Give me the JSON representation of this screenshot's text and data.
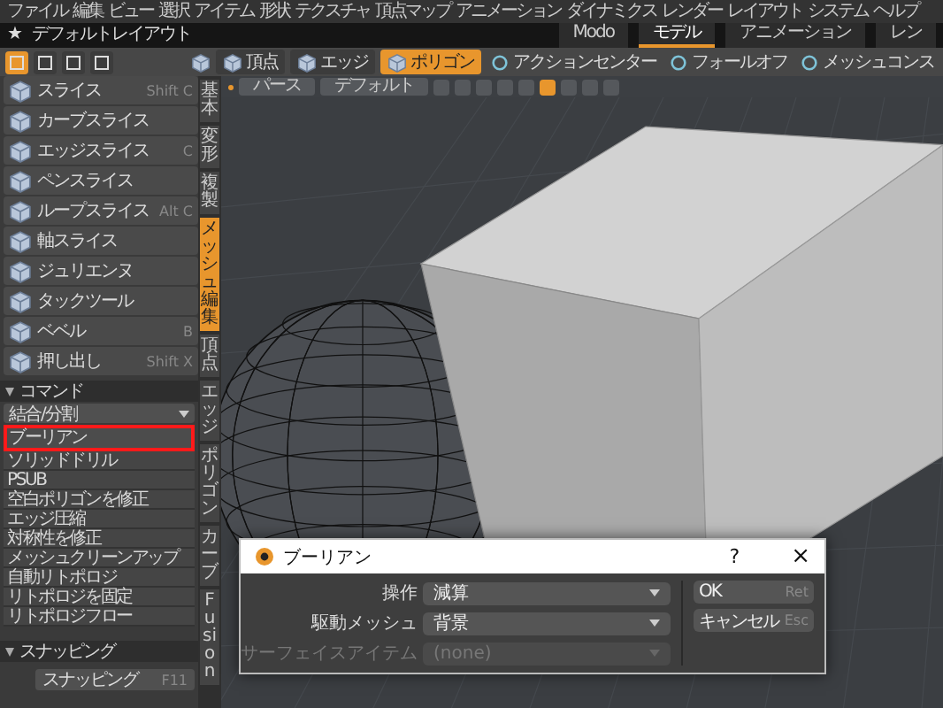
{
  "menu_bar": [
    "ファイル",
    "編集",
    "ビュー",
    "選択",
    "アイテム",
    "形状",
    "テクスチャ",
    "頂点マップ",
    "アニメーション",
    "ダイナミクス",
    "レンダー",
    "レイアウト",
    "システム",
    "ヘルプ"
  ],
  "title_bar": {
    "icon": "★",
    "title": "デフォルトレイアウト",
    "tabs": [
      {
        "label": "Modo",
        "selected": false
      },
      {
        "label": "モデル",
        "selected": true
      },
      {
        "label": "アニメーション",
        "selected": false
      },
      {
        "label": "レン",
        "selected": false
      }
    ]
  },
  "toolbar": {
    "tool_buttons": [
      {
        "selected": true
      },
      {
        "selected": false
      },
      {
        "selected": false
      },
      {
        "selected": false
      }
    ],
    "modes": [
      {
        "label": "頂点",
        "selected": false
      },
      {
        "label": "エッジ",
        "selected": false
      },
      {
        "label": "ポリゴン",
        "selected": true
      }
    ],
    "actions": [
      "アクションセンター",
      "フォールオフ",
      "メッシュコンス"
    ]
  },
  "tools": [
    {
      "label": "スライス",
      "shortcut": "Shift C"
    },
    {
      "label": "カーブスライス"
    },
    {
      "label": "エッジスライス",
      "shortcut": "C"
    },
    {
      "label": "ペンスライス"
    },
    {
      "label": "ループスライス",
      "shortcut": "Alt C"
    },
    {
      "label": "軸スライス"
    },
    {
      "label": "ジュリエンヌ"
    },
    {
      "label": "タックツール"
    },
    {
      "label": "ベベル",
      "shortcut": "B"
    },
    {
      "label": "押し出し",
      "shortcut": "Shift X"
    }
  ],
  "side_tabs": [
    {
      "label": "基本",
      "selected": false
    },
    {
      "label": "変形",
      "selected": false
    },
    {
      "label": "複製",
      "selected": false
    },
    {
      "label": "メッシュ編集",
      "selected": true
    },
    {
      "label": "頂点",
      "selected": false
    },
    {
      "label": "エッジ",
      "selected": false
    },
    {
      "label": "ポリゴン",
      "selected": false
    },
    {
      "label": "カーブ",
      "selected": false
    },
    {
      "label": "Fusion",
      "selected": false
    }
  ],
  "commands": {
    "title": "コマンド",
    "filter": "結合/分割",
    "items": [
      {
        "label": "ブーリアン",
        "highlighted": true
      },
      {
        "label": "ソリッドドリル",
        "highlighted": false
      },
      {
        "label": "PSUB",
        "highlighted": false
      },
      {
        "label": "空白ポリゴンを修正",
        "highlighted": false
      },
      {
        "label": "エッジ圧縮",
        "highlighted": false
      },
      {
        "label": "対称性を修正",
        "highlighted": false
      },
      {
        "label": "メッシュクリーンアップ",
        "highlighted": false
      },
      {
        "label": "自動リトポロジ",
        "highlighted": false
      },
      {
        "label": "リトポロジを固定",
        "highlighted": false
      },
      {
        "label": "リトポロジフロー",
        "highlighted": false
      }
    ]
  },
  "snapping": {
    "title": "スナッピング",
    "button": {
      "label": "スナッピング",
      "shortcut": "F11"
    }
  },
  "viewport": {
    "view": "パース",
    "style": "デフォルト",
    "shading_buttons": [
      {
        "selected": false
      },
      {
        "selected": false
      },
      {
        "selected": false
      },
      {
        "selected": false
      },
      {
        "selected": false
      },
      {
        "selected": true
      },
      {
        "selected": false
      },
      {
        "selected": false
      },
      {
        "selected": false
      }
    ]
  },
  "dialog": {
    "title": "ブーリアン",
    "help": "?",
    "close": "×",
    "fields": [
      {
        "label": "操作",
        "value": "減算",
        "disabled": false
      },
      {
        "label": "駆動メッシュ",
        "value": "背景",
        "disabled": false
      },
      {
        "label": "サーフェイスアイテム",
        "value": "(none)",
        "disabled": true
      }
    ],
    "buttons": [
      {
        "label": "OK",
        "shortcut": "Ret"
      },
      {
        "label": "キャンセル",
        "shortcut": "Esc"
      }
    ]
  }
}
